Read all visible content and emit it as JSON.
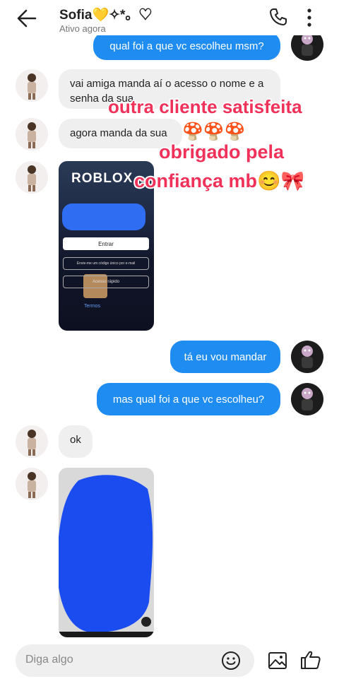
{
  "header": {
    "contact_name": "Sofia💛✧*。♡",
    "status": "Ativo agora"
  },
  "messages": [
    {
      "side": "out",
      "text": "qual foi a que vc escolheu msm?"
    },
    {
      "side": "in",
      "text": "vai amiga manda aí o acesso o nome e a senha da sua"
    },
    {
      "side": "in",
      "text": "agora manda da sua"
    },
    {
      "side": "in",
      "type": "image",
      "app_logo": "ROBLOX",
      "login_button": "Entrar",
      "email_option": "Envie-me um código único por e-mail",
      "other_option": "Acesso rápido",
      "terms": "Termos"
    },
    {
      "side": "out",
      "text": "tá eu vou mandar"
    },
    {
      "side": "out",
      "text": "mas qual foi a que vc escolheu?"
    },
    {
      "side": "in",
      "text": "ok"
    },
    {
      "side": "in",
      "type": "image"
    }
  ],
  "overlays": {
    "line1": "outra cliente satisfeita",
    "line2": "🍄🍄🍄",
    "line3": "obrigado pela",
    "line4": "confiança mb😊🎀"
  },
  "composer": {
    "placeholder": "Diga algo"
  },
  "colors": {
    "outgoing_bubble": "#1e8cf0",
    "incoming_bubble": "#efefef",
    "overlay_text": "#f0325a",
    "scribble": "#1a4cf0"
  },
  "icons": [
    "back-arrow-icon",
    "phone-icon",
    "more-vert-icon",
    "emoji-icon",
    "gallery-icon",
    "like-icon"
  ]
}
